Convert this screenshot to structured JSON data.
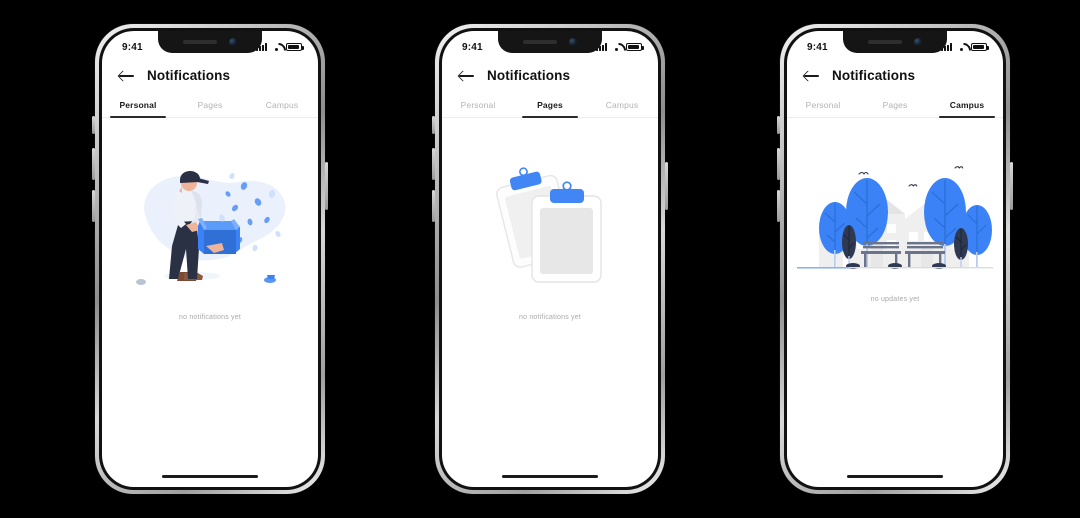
{
  "canvas": {
    "background": "#000000",
    "accent_blue": "#4285f4",
    "light_blue": "#eaf1fd",
    "text_dark": "#1a1a1a",
    "text_muted": "#a9a9a9"
  },
  "phones": [
    {
      "id": "phone-personal",
      "statusbar": {
        "time": "9:41",
        "signal_icon": "cellular-signal-icon",
        "wifi_icon": "wifi-icon",
        "battery_icon": "battery-icon"
      },
      "header": {
        "back_icon": "back-arrow-icon",
        "title": "Notifications"
      },
      "tabs": [
        {
          "label": "Personal",
          "active": true
        },
        {
          "label": "Pages",
          "active": false
        },
        {
          "label": "Campus",
          "active": false
        }
      ],
      "illustration": "person-carrying-box-illustration",
      "caption": "no notifications yet"
    },
    {
      "id": "phone-pages",
      "statusbar": {
        "time": "9:41",
        "signal_icon": "cellular-signal-icon",
        "wifi_icon": "wifi-icon",
        "battery_icon": "battery-icon"
      },
      "header": {
        "back_icon": "back-arrow-icon",
        "title": "Notifications"
      },
      "tabs": [
        {
          "label": "Personal",
          "active": false
        },
        {
          "label": "Pages",
          "active": true
        },
        {
          "label": "Campus",
          "active": false
        }
      ],
      "illustration": "clipboards-illustration",
      "caption": "no notifications yet"
    },
    {
      "id": "phone-campus",
      "statusbar": {
        "time": "9:41",
        "signal_icon": "cellular-signal-icon",
        "wifi_icon": "wifi-icon",
        "battery_icon": "battery-icon"
      },
      "header": {
        "back_icon": "back-arrow-icon",
        "title": "Notifications"
      },
      "tabs": [
        {
          "label": "Personal",
          "active": false
        },
        {
          "label": "Pages",
          "active": false
        },
        {
          "label": "Campus",
          "active": true
        }
      ],
      "illustration": "campus-park-illustration",
      "caption": "no updates yet"
    }
  ]
}
